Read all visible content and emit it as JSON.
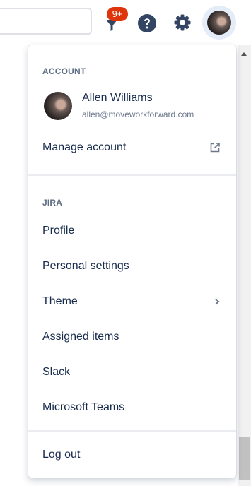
{
  "topbar": {
    "notifications_badge": "9+",
    "search_value": "",
    "icons": [
      "notification-icon",
      "help-icon",
      "gear-icon",
      "avatar"
    ]
  },
  "account": {
    "heading": "ACCOUNT",
    "user_name": "Allen Williams",
    "user_email": "allen@moveworkforward.com",
    "manage_label": "Manage account"
  },
  "jira": {
    "heading": "JIRA",
    "items": [
      {
        "label": "Profile"
      },
      {
        "label": "Personal settings"
      },
      {
        "label": "Theme"
      },
      {
        "label": "Assigned items"
      },
      {
        "label": "Slack"
      },
      {
        "label": "Microsoft Teams"
      }
    ]
  },
  "logout_label": "Log out",
  "colors": {
    "text": "#172b4d",
    "heading": "#5e6c84",
    "badge": "#de350b",
    "icon": "#344563",
    "avatar_ring": "#e4ecf7"
  }
}
